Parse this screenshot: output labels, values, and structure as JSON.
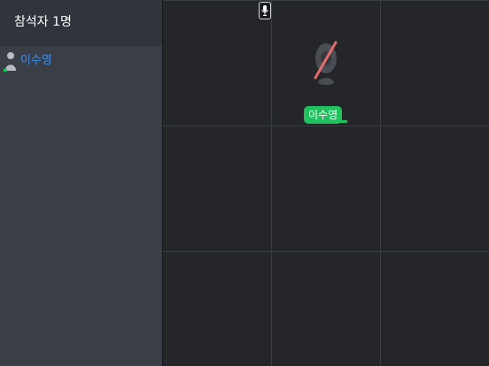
{
  "sidebar": {
    "title": "참석자 1명",
    "participants": [
      {
        "name": "이수영",
        "icon": "person-icon",
        "status_color": "#1fc25c"
      }
    ]
  },
  "grid": {
    "columns": 3,
    "rows": 3,
    "tile": {
      "name_tag": "이수영",
      "camera_icon": "camera-off-icon",
      "mic_icon": "microphone-icon",
      "tag_color": "#1fc25c"
    }
  },
  "colors": {
    "sidebar_bg": "#3a3e47",
    "sidebar_header_bg": "#30343c",
    "grid_bg": "#24262a",
    "accent_blue": "#3f8ff0",
    "camera_off_slash": "#e46b6b"
  }
}
